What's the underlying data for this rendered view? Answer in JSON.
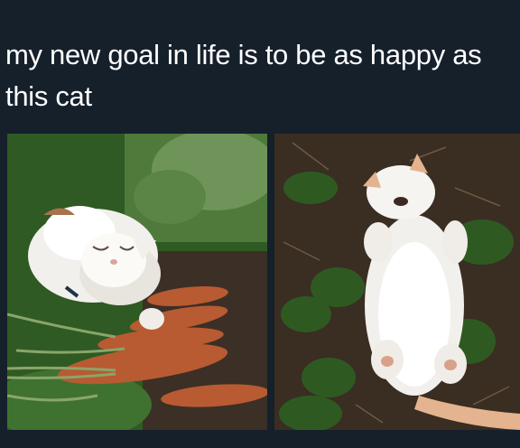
{
  "post": {
    "caption_line_1": "my new goal in life is to be as happy as",
    "caption_line_2": "this cat"
  },
  "photos": [
    {
      "subject": "white cat lying on carrots in grass, eyes closed"
    },
    {
      "subject": "white cat lying on its back on soil and grass"
    }
  ],
  "colors": {
    "background": "#15202b",
    "caption_text": "#ffffff",
    "cat_white": "#f2f0ec",
    "carrot_orange": "#b85a32",
    "grass_green": "#3c6a2a",
    "soil_brown": "#3a2d22"
  }
}
